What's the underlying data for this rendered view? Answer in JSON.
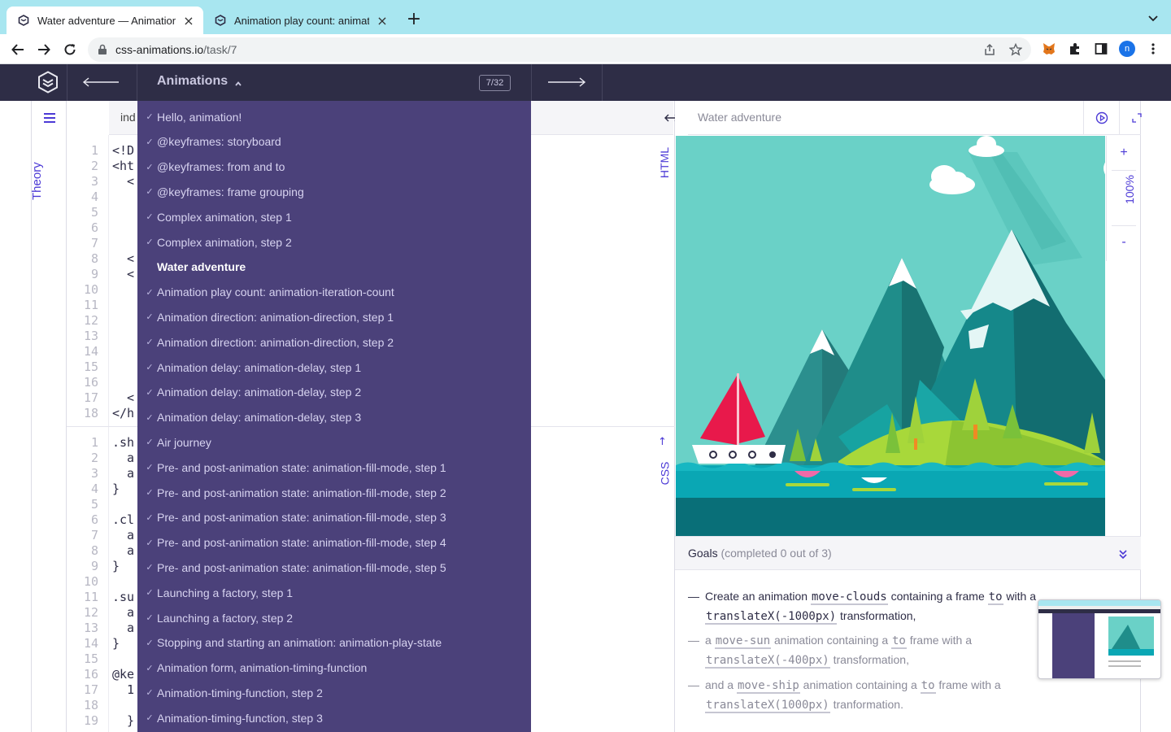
{
  "browser": {
    "tabs": [
      {
        "title": "Water adventure — Animations",
        "active": true
      },
      {
        "title": "Animation play count: animatio",
        "active": false
      }
    ],
    "url_host": "css-animations.io",
    "url_path": "/task/7",
    "profile_initial": "n"
  },
  "app": {
    "section_title": "Animations",
    "progress": "7/32"
  },
  "rail": {
    "theory_label": "Theory"
  },
  "editor": {
    "file_tab": "ind",
    "html_label": "HTML",
    "css_label": "CSS",
    "html_lines": [
      {
        "n": "1",
        "code": "<!D"
      },
      {
        "n": "2",
        "code": "<ht"
      },
      {
        "n": "3",
        "code": "  <"
      },
      {
        "n": "4",
        "code": ""
      },
      {
        "n": "5",
        "code": ""
      },
      {
        "n": "6",
        "code": ""
      },
      {
        "n": "7",
        "code": ""
      },
      {
        "n": "8",
        "code": "  <"
      },
      {
        "n": "9",
        "code": "  <"
      },
      {
        "n": "10",
        "code": ""
      },
      {
        "n": "11",
        "code": ""
      },
      {
        "n": "12",
        "code": ""
      },
      {
        "n": "13",
        "code": ""
      },
      {
        "n": "14",
        "code": ""
      },
      {
        "n": "15",
        "code": ""
      },
      {
        "n": "16",
        "code": ""
      },
      {
        "n": "17",
        "code": "  <"
      },
      {
        "n": "18",
        "code": "</h"
      }
    ],
    "css_lines": [
      {
        "n": "1",
        "code": ".sh"
      },
      {
        "n": "2",
        "code": "  a"
      },
      {
        "n": "3",
        "code": "  a"
      },
      {
        "n": "4",
        "code": "}"
      },
      {
        "n": "5",
        "code": ""
      },
      {
        "n": "6",
        "code": ".cl"
      },
      {
        "n": "7",
        "code": "  a"
      },
      {
        "n": "8",
        "code": "  a"
      },
      {
        "n": "9",
        "code": "}"
      },
      {
        "n": "10",
        "code": ""
      },
      {
        "n": "11",
        "code": ".su"
      },
      {
        "n": "12",
        "code": "  a"
      },
      {
        "n": "13",
        "code": "  a"
      },
      {
        "n": "14",
        "code": "}"
      },
      {
        "n": "15",
        "code": ""
      },
      {
        "n": "16",
        "code": "@ke"
      },
      {
        "n": "17",
        "code": "  1"
      },
      {
        "n": "18",
        "code": ""
      },
      {
        "n": "19",
        "code": "  }"
      }
    ]
  },
  "dropdown": {
    "items": [
      {
        "label": "Hello, animation!",
        "done": true
      },
      {
        "label": "@keyframes: storyboard",
        "done": true
      },
      {
        "label": "@keyframes: from and to",
        "done": true
      },
      {
        "label": "@keyframes: frame grouping",
        "done": true
      },
      {
        "label": "Complex animation, step 1",
        "done": true
      },
      {
        "label": "Complex animation, step 2",
        "done": true
      },
      {
        "label": "Water adventure",
        "done": false,
        "current": true
      },
      {
        "label": "Animation play count: animation-iteration-count",
        "done": true
      },
      {
        "label": "Animation direction: animation-direction, step 1",
        "done": true
      },
      {
        "label": "Animation direction: animation-direction, step 2",
        "done": true
      },
      {
        "label": "Animation delay: animation-delay, step 1",
        "done": true
      },
      {
        "label": "Animation delay: animation-delay, step 2",
        "done": true
      },
      {
        "label": "Animation delay: animation-delay, step 3",
        "done": true
      },
      {
        "label": "Air journey",
        "done": true
      },
      {
        "label": "Pre- and post-animation state: animation-fill-mode, step 1",
        "done": true
      },
      {
        "label": "Pre- and post-animation state: animation-fill-mode, step 2",
        "done": true
      },
      {
        "label": "Pre- and post-animation state: animation-fill-mode, step 3",
        "done": true
      },
      {
        "label": "Pre- and post-animation state: animation-fill-mode, step 4",
        "done": true
      },
      {
        "label": "Pre- and post-animation state: animation-fill-mode, step 5",
        "done": true
      },
      {
        "label": "Launching a factory, step 1",
        "done": true
      },
      {
        "label": "Launching a factory, step 2",
        "done": true
      },
      {
        "label": "Stopping and starting an animation: animation-play-state",
        "done": true
      },
      {
        "label": "Animation form, animation-timing-function",
        "done": true
      },
      {
        "label": "Animation-timing-function, step 2",
        "done": true
      },
      {
        "label": "Animation-timing-function, step 3",
        "done": true
      }
    ]
  },
  "preview": {
    "title": "Water adventure",
    "zoom_plus": "+",
    "zoom_value": "100%",
    "zoom_minus": "-"
  },
  "goals": {
    "label": "Goals",
    "count_text": "(completed 0 out of 3)",
    "items": [
      {
        "parts": [
          {
            "t": "Create an animation ",
            "kw": false
          },
          {
            "t": "move-clouds",
            "kw": true
          },
          {
            "t": " containing a frame ",
            "kw": false
          },
          {
            "t": "to",
            "kw": true
          },
          {
            "t": " with a ",
            "kw": false
          },
          {
            "t": "translateX(-1000px)",
            "kw": true
          },
          {
            "t": " transformation,",
            "kw": false
          }
        ],
        "dim": false
      },
      {
        "parts": [
          {
            "t": "a ",
            "kw": false
          },
          {
            "t": "move-sun",
            "kw": true
          },
          {
            "t": " animation containing a ",
            "kw": false
          },
          {
            "t": "to",
            "kw": true
          },
          {
            "t": " frame with a ",
            "kw": false
          },
          {
            "t": "translateX(-400px)",
            "kw": true
          },
          {
            "t": " transformation,",
            "kw": false
          }
        ],
        "dim": true
      },
      {
        "parts": [
          {
            "t": "and a ",
            "kw": false
          },
          {
            "t": "move-ship",
            "kw": true
          },
          {
            "t": " animation containing a ",
            "kw": false
          },
          {
            "t": "to",
            "kw": true
          },
          {
            "t": " frame with a ",
            "kw": false
          },
          {
            "t": "translateX(1000px)",
            "kw": true
          },
          {
            "t": " tranformation.",
            "kw": false
          }
        ],
        "dim": true
      }
    ]
  },
  "colors": {
    "tabstrip": "#a8e6f0",
    "appbar": "#2e2d46",
    "dropdown": "#4b417a",
    "accent": "#4c3ad6",
    "sky": "#6ad1c7",
    "sea": "#0aa7b4"
  }
}
